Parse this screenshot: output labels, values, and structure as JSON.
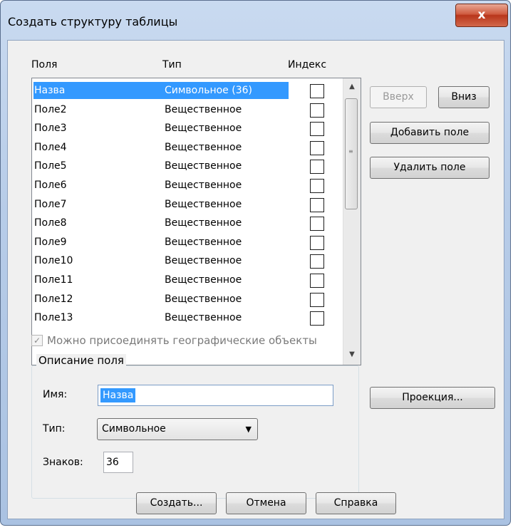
{
  "dialog": {
    "title": "Создать структуру таблицы",
    "close_glyph": "x"
  },
  "columns": {
    "field": "Поля",
    "type": "Тип",
    "index": "Индекс"
  },
  "fields": [
    {
      "name": "Назва",
      "type": "Символьное (36)",
      "indexed": false,
      "selected": true
    },
    {
      "name": "Поле2",
      "type": "Вещественное",
      "indexed": false,
      "selected": false
    },
    {
      "name": "Поле3",
      "type": "Вещественное",
      "indexed": false,
      "selected": false
    },
    {
      "name": "Поле4",
      "type": "Вещественное",
      "indexed": false,
      "selected": false
    },
    {
      "name": "Поле5",
      "type": "Вещественное",
      "indexed": false,
      "selected": false
    },
    {
      "name": "Поле6",
      "type": "Вещественное",
      "indexed": false,
      "selected": false
    },
    {
      "name": "Поле7",
      "type": "Вещественное",
      "indexed": false,
      "selected": false
    },
    {
      "name": "Поле8",
      "type": "Вещественное",
      "indexed": false,
      "selected": false
    },
    {
      "name": "Поле9",
      "type": "Вещественное",
      "indexed": false,
      "selected": false
    },
    {
      "name": "Поле10",
      "type": "Вещественное",
      "indexed": false,
      "selected": false
    },
    {
      "name": "Поле11",
      "type": "Вещественное",
      "indexed": false,
      "selected": false
    },
    {
      "name": "Поле12",
      "type": "Вещественное",
      "indexed": false,
      "selected": false
    },
    {
      "name": "Поле13",
      "type": "Вещественное",
      "indexed": false,
      "selected": false
    }
  ],
  "buttons": {
    "up": "Вверх",
    "down": "Вниз",
    "add_field": "Добавить поле",
    "delete_field": "Удалить поле",
    "projection": "Проекция...",
    "create": "Создать...",
    "cancel": "Отмена",
    "help": "Справка"
  },
  "geo_option": {
    "label": "Можно присоединять географические объекты",
    "checked": true,
    "enabled": false
  },
  "field_description": {
    "group_title": "Описание поля",
    "name_label": "Имя:",
    "name_value": "Назва",
    "type_label": "Тип:",
    "type_value": "Символьное",
    "width_label": "Знаков:",
    "width_value": "36"
  },
  "colors": {
    "selection": "#3399ff",
    "close_button": "#c8462a"
  }
}
